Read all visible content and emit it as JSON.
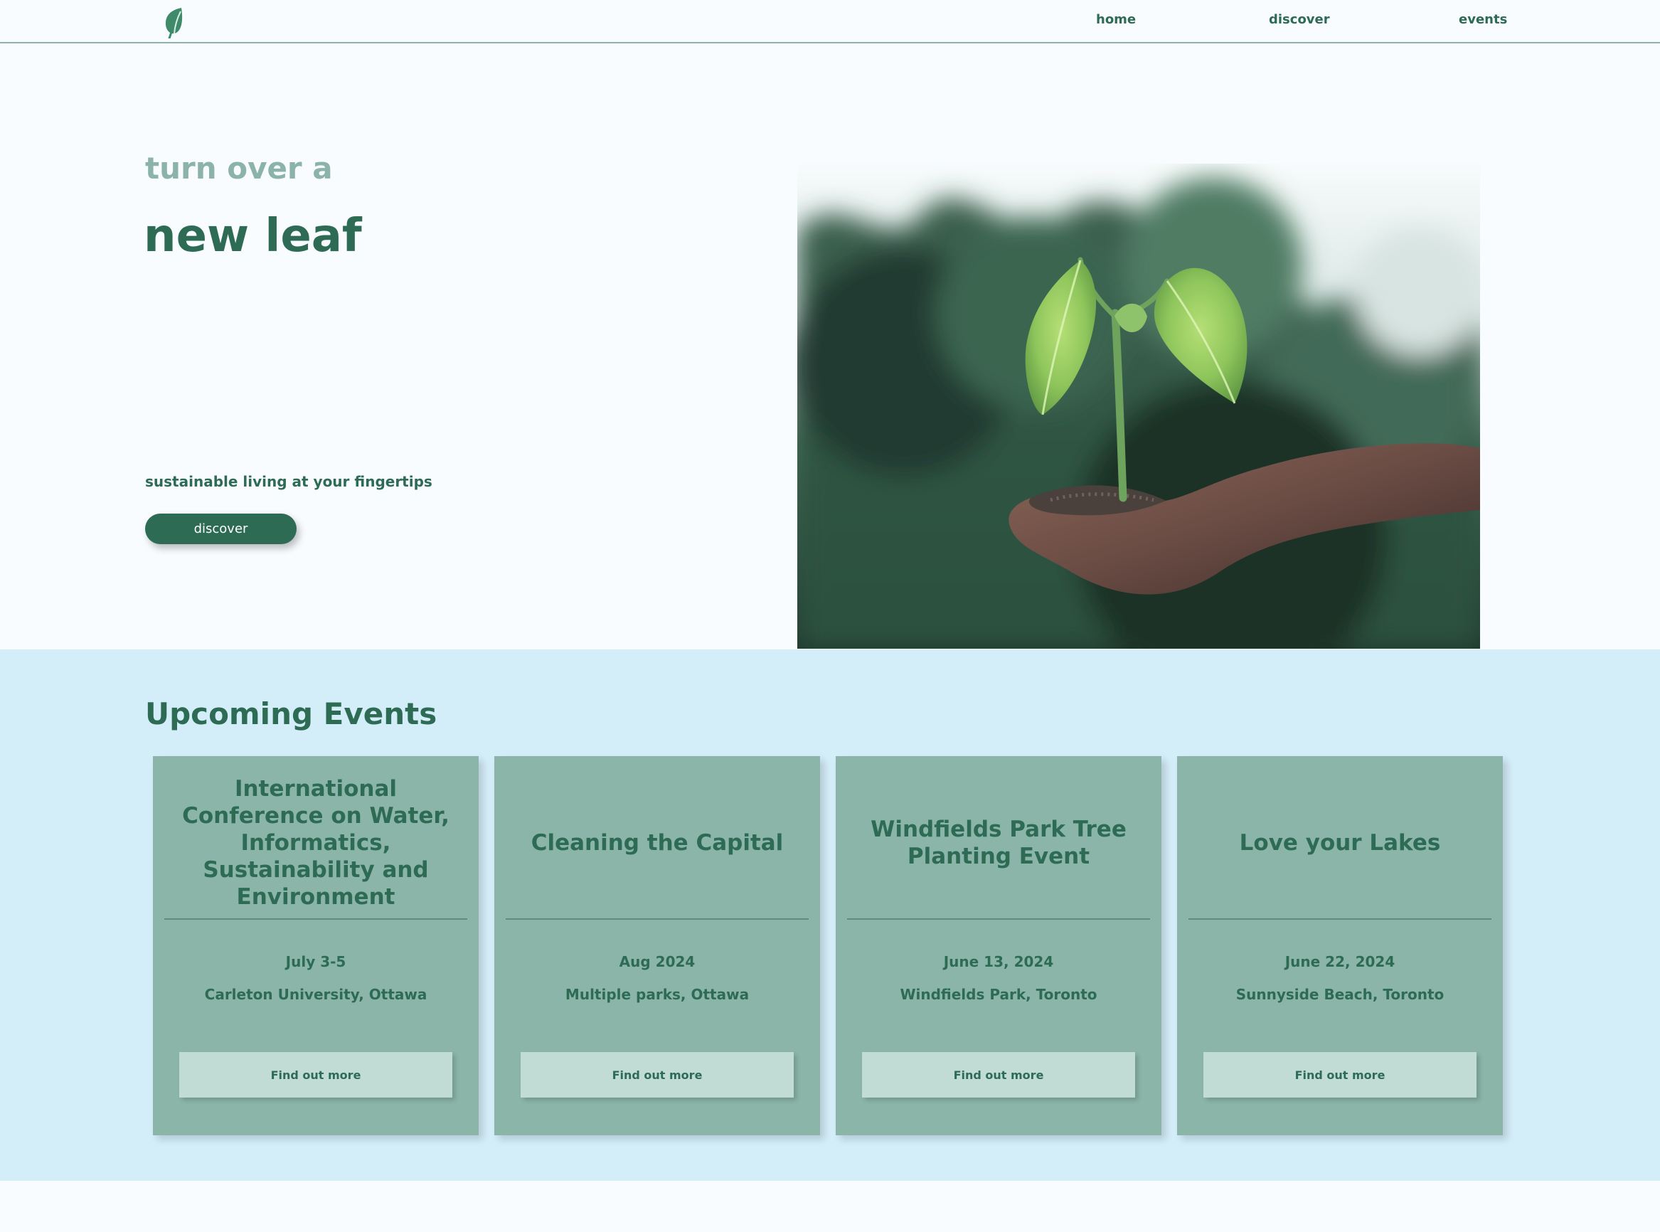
{
  "nav": {
    "logo_icon": "leaf-icon",
    "links": [
      {
        "label": "home"
      },
      {
        "label": "discover"
      },
      {
        "label": "events"
      }
    ]
  },
  "hero": {
    "kicker": "turn over a",
    "title": "new leaf",
    "tagline": "sustainable living at your fingertips",
    "button_label": "discover",
    "image": "hand holding seedling photo"
  },
  "events": {
    "heading": "Upcoming Events",
    "cards": [
      {
        "title": "International Conference on Water, Informatics, Sustainability and Environment",
        "date": "July 3-5",
        "location": "Carleton University, Ottawa",
        "button_label": "Find out more"
      },
      {
        "title": "Cleaning the Capital",
        "date": "Aug 2024",
        "location": "Multiple parks, Ottawa",
        "button_label": "Find out more"
      },
      {
        "title": "Windfields Park Tree Planting Event",
        "date": "June 13, 2024",
        "location": "Windfields Park, Toronto",
        "button_label": "Find out more"
      },
      {
        "title": "Love your Lakes",
        "date": "June 22, 2024",
        "location": "Sunnyside Beach, Toronto",
        "button_label": "Find out more"
      }
    ]
  },
  "colors": {
    "page_background": "#f8fcfe",
    "brand_green": "#2e6b55",
    "muted_green": "#8bb3a8",
    "events_background": "#d3edf9",
    "card_background": "#8bb5a9",
    "card_button": "#c1dbd5"
  }
}
